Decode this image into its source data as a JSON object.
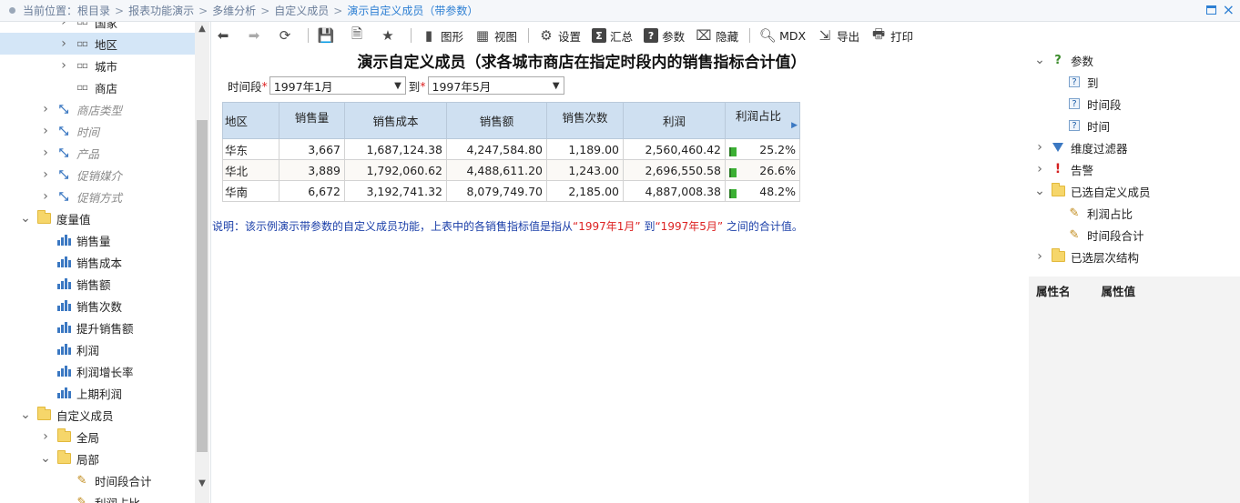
{
  "breadcrumb": {
    "prefix": "当前位置：",
    "items": [
      "根目录",
      "报表功能演示",
      "多维分析",
      "自定义成员",
      "演示自定义成员（带参数）"
    ],
    "sep": ">"
  },
  "left_tree": [
    {
      "label": "国家",
      "level": 3,
      "icon": "level-icon",
      "chevron": ">"
    },
    {
      "label": "地区",
      "level": 3,
      "icon": "level-icon",
      "chevron": ">",
      "selected": true
    },
    {
      "label": "城市",
      "level": 3,
      "icon": "level-icon",
      "chevron": ">"
    },
    {
      "label": "商店",
      "level": 3,
      "icon": "level-icon",
      "chevron": ""
    },
    {
      "label": "商店类型",
      "level": 2,
      "icon": "dimension-icon",
      "chevron": ">",
      "italic": true
    },
    {
      "label": "时间",
      "level": 2,
      "icon": "dimension-icon",
      "chevron": ">",
      "italic": true
    },
    {
      "label": "产品",
      "level": 2,
      "icon": "dimension-icon",
      "chevron": ">",
      "italic": true
    },
    {
      "label": "促销媒介",
      "level": 2,
      "icon": "dimension-icon",
      "chevron": ">",
      "italic": true
    },
    {
      "label": "促销方式",
      "level": 2,
      "icon": "dimension-icon",
      "chevron": ">",
      "italic": true
    },
    {
      "label": "度量值",
      "level": 1,
      "icon": "folder-icon",
      "chevron": "v"
    },
    {
      "label": "销售量",
      "level": 2,
      "icon": "measure-icon",
      "chevron": ""
    },
    {
      "label": "销售成本",
      "level": 2,
      "icon": "measure-icon",
      "chevron": ""
    },
    {
      "label": "销售额",
      "level": 2,
      "icon": "measure-icon",
      "chevron": ""
    },
    {
      "label": "销售次数",
      "level": 2,
      "icon": "measure-icon",
      "chevron": ""
    },
    {
      "label": "提升销售额",
      "level": 2,
      "icon": "measure-icon",
      "chevron": ""
    },
    {
      "label": "利润",
      "level": 2,
      "icon": "measure-icon",
      "chevron": ""
    },
    {
      "label": "利润增长率",
      "level": 2,
      "icon": "measure-icon",
      "chevron": ""
    },
    {
      "label": "上期利润",
      "level": 2,
      "icon": "measure-icon",
      "chevron": ""
    },
    {
      "label": "自定义成员",
      "level": 1,
      "icon": "folder-icon",
      "chevron": "v"
    },
    {
      "label": "全局",
      "level": 2,
      "icon": "folder-icon",
      "chevron": ">"
    },
    {
      "label": "局部",
      "level": 2,
      "icon": "folder-icon",
      "chevron": "v"
    },
    {
      "label": "时间段合计",
      "level": 3,
      "icon": "custom-member-icon",
      "chevron": ""
    },
    {
      "label": "利润占比",
      "level": 3,
      "icon": "custom-member-icon",
      "chevron": ""
    }
  ],
  "toolbar": {
    "chart": "图形",
    "view": "视图",
    "settings": "设置",
    "summary": "汇总",
    "params": "参数",
    "hide": "隐藏",
    "mdx": "MDX",
    "export": "导出",
    "print": "打印"
  },
  "report": {
    "title": "演示自定义成员（求各城市商店在指定时段内的销售指标合计值）",
    "period_label": "时间段",
    "req_mark": "*",
    "from_value": "1997年1月",
    "to_label": "到",
    "to_value": "1997年5月"
  },
  "table": {
    "headers": [
      "地区",
      "销售量",
      "销售成本",
      "销售额",
      "销售次数",
      "利润",
      "利润占比"
    ],
    "rows": [
      [
        "华东",
        "3,667",
        "1,687,124.38",
        "4,247,584.80",
        "1,189.00",
        "2,560,460.42",
        "25.2%"
      ],
      [
        "华北",
        "3,889",
        "1,792,060.62",
        "4,488,611.20",
        "1,243.00",
        "2,696,550.58",
        "26.6%"
      ],
      [
        "华南",
        "6,672",
        "3,192,741.32",
        "8,079,749.70",
        "2,185.00",
        "4,887,008.38",
        "48.2%"
      ]
    ]
  },
  "note": {
    "part1": "说明：该示例演示带参数的自定义成员功能，上表中的各销售指标值是指从",
    "q1": "“1997年1月”",
    "part2": "到",
    "q2": "“1997年5月”",
    "part3": "之间的合计值。"
  },
  "right_tree": [
    {
      "label": "参数",
      "level": 1,
      "icon": "question-icon",
      "chevron": "v"
    },
    {
      "label": "到",
      "level": 2,
      "icon": "param-icon",
      "chevron": ""
    },
    {
      "label": "时间段",
      "level": 2,
      "icon": "param-icon",
      "chevron": ""
    },
    {
      "label": "时间",
      "level": 2,
      "icon": "param-icon",
      "chevron": ""
    },
    {
      "label": "维度过滤器",
      "level": 1,
      "icon": "filter-icon",
      "chevron": ">"
    },
    {
      "label": "告警",
      "level": 1,
      "icon": "alarm-icon",
      "chevron": ">"
    },
    {
      "label": "已选自定义成员",
      "level": 1,
      "icon": "folder-icon",
      "chevron": "v"
    },
    {
      "label": "利润占比",
      "level": 2,
      "icon": "custom-member-icon",
      "chevron": ""
    },
    {
      "label": "时间段合计",
      "level": 2,
      "icon": "custom-member-icon",
      "chevron": ""
    },
    {
      "label": "已选层次结构",
      "level": 1,
      "icon": "folder-icon",
      "chevron": ">"
    }
  ],
  "props": {
    "name": "属性名",
    "value": "属性值"
  }
}
